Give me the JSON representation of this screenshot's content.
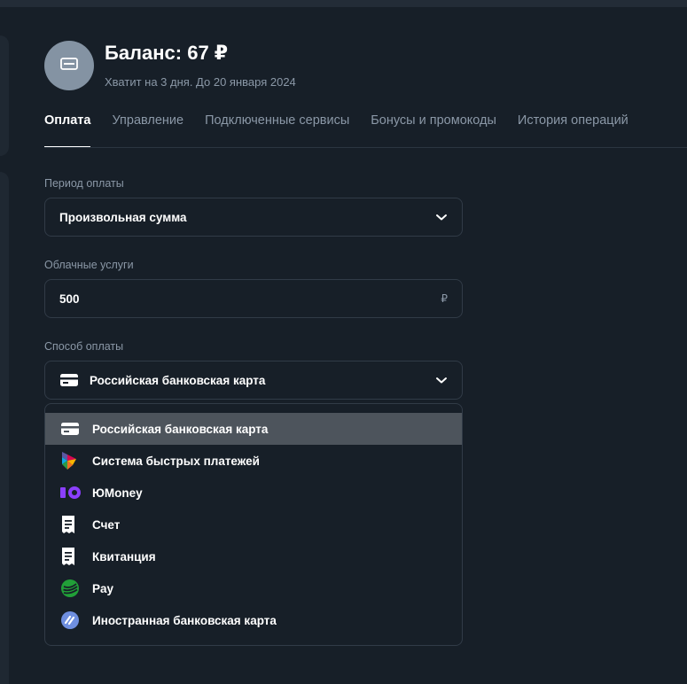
{
  "header": {
    "balance_title": "Баланс: 67 ₽",
    "balance_subtitle": "Хватит на 3 дня. До 20 января 2024"
  },
  "tabs": [
    {
      "label": "Оплата",
      "active": true
    },
    {
      "label": "Управление",
      "active": false
    },
    {
      "label": "Подключенные сервисы",
      "active": false
    },
    {
      "label": "Бонусы и промокоды",
      "active": false
    },
    {
      "label": "История операций",
      "active": false
    }
  ],
  "form": {
    "period_label": "Период оплаты",
    "period_value": "Произвольная сумма",
    "cloud_label": "Облачные услуги",
    "cloud_value": "500",
    "cloud_currency": "₽",
    "method_label": "Способ оплаты",
    "method_value": "Российская банковская карта"
  },
  "payment_options": [
    {
      "label": "Российская банковская карта",
      "icon": "card-icon",
      "selected": true
    },
    {
      "label": "Система быстрых платежей",
      "icon": "sbp-icon",
      "selected": false
    },
    {
      "label": "ЮMoney",
      "icon": "yoomoney-icon",
      "selected": false
    },
    {
      "label": "Счет",
      "icon": "invoice-icon",
      "selected": false
    },
    {
      "label": "Квитанция",
      "icon": "receipt-icon",
      "selected": false
    },
    {
      "label": "Pay",
      "icon": "sber-pay-icon",
      "selected": false
    },
    {
      "label": "Иностранная банковская карта",
      "icon": "foreign-card-icon",
      "selected": false
    }
  ],
  "colors": {
    "background": "#171f28",
    "muted_text": "#8b98a7",
    "selected_option_bg": "#4d545c",
    "yoomoney": "#8b3ffd",
    "sber": "#21a038",
    "foreign_card": "#6f8fe0"
  }
}
